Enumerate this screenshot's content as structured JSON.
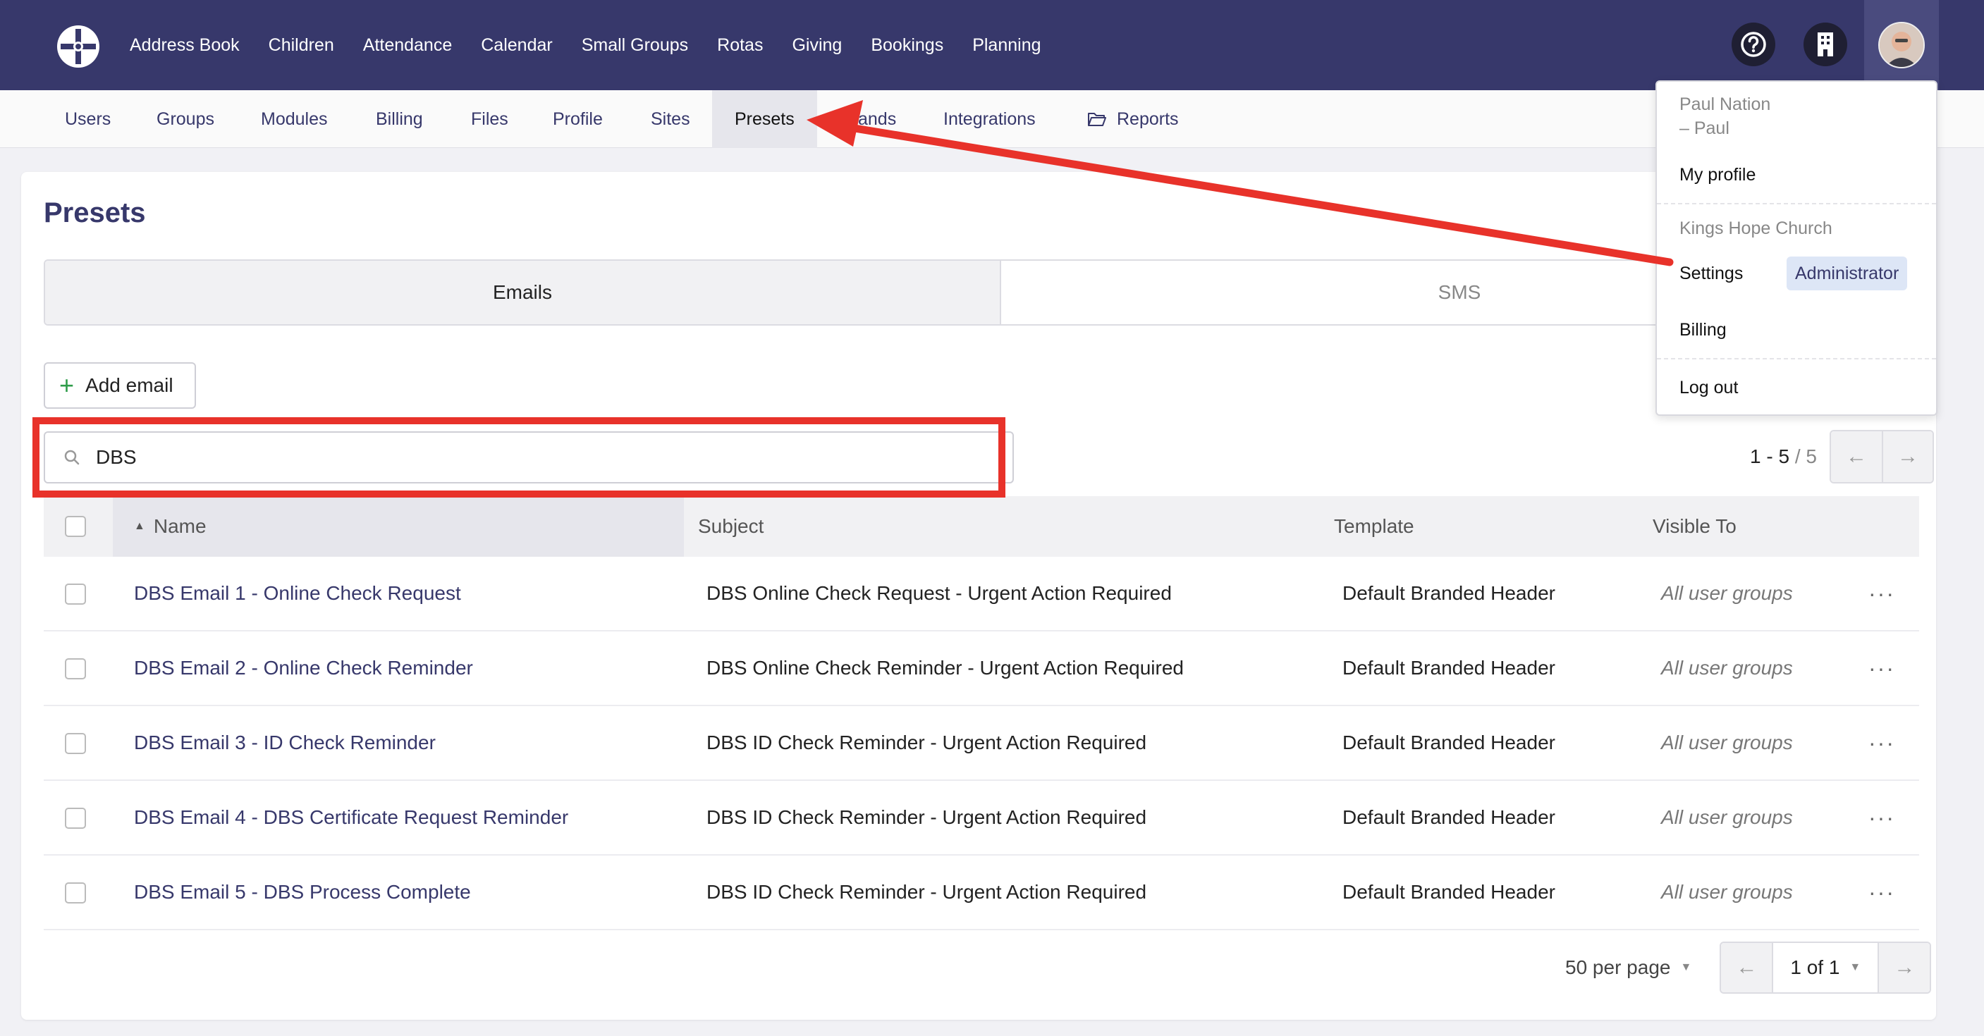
{
  "topnav": {
    "links": [
      "Address Book",
      "Children",
      "Attendance",
      "Calendar",
      "Small Groups",
      "Rotas",
      "Giving",
      "Bookings",
      "Planning"
    ]
  },
  "subnav": {
    "items": [
      "Users",
      "Groups",
      "Modules",
      "Billing",
      "Files",
      "Profile",
      "Sites",
      "Presets",
      "Brands",
      "Integrations",
      "Reports"
    ],
    "active": "Presets"
  },
  "page": {
    "title": "Presets",
    "tabs": [
      "Emails",
      "SMS"
    ],
    "add_label": "Add email"
  },
  "search": {
    "value": "DBS"
  },
  "pager_top": {
    "range": "1 - 5",
    "total": "/ 5"
  },
  "table": {
    "headers": [
      "Name",
      "Subject",
      "Template",
      "Visible To"
    ],
    "rows": [
      {
        "name": "DBS Email 1 - Online Check Request",
        "subject": "DBS Online Check Request - Urgent Action Required",
        "template": "Default Branded Header",
        "visible": "All user groups"
      },
      {
        "name": "DBS Email 2 - Online Check Reminder",
        "subject": "DBS Online Check Reminder - Urgent Action Required",
        "template": "Default Branded Header",
        "visible": "All user groups"
      },
      {
        "name": "DBS Email 3 - ID Check Reminder",
        "subject": "DBS ID Check Reminder - Urgent Action Required",
        "template": "Default Branded Header",
        "visible": "All user groups"
      },
      {
        "name": "DBS Email 4 - DBS Certificate Request Reminder",
        "subject": "DBS ID Check Reminder - Urgent Action Required",
        "template": "Default Branded Header",
        "visible": "All user groups"
      },
      {
        "name": "DBS Email 5 - DBS Process Complete",
        "subject": "DBS ID Check Reminder - Urgent Action Required",
        "template": "Default Branded Header",
        "visible": "All user groups"
      }
    ],
    "row_menu": "···"
  },
  "pager_bottom": {
    "per_page": "50 per page",
    "page": "1 of 1"
  },
  "dropdown": {
    "user_name": "Paul Nation",
    "user_nick": "– Paul",
    "my_profile": "My profile",
    "org": "Kings Hope Church",
    "settings": "Settings",
    "role_badge": "Administrator",
    "billing": "Billing",
    "logout": "Log out"
  },
  "icons": {
    "logo": "church-logo-icon",
    "help": "question-circle-icon",
    "building": "building-icon",
    "search": "search-icon",
    "arrow_left": "arrow-left-icon",
    "arrow_right": "arrow-right-icon",
    "folder": "folder-open-icon"
  },
  "colors": {
    "topnav": "#37386b",
    "link": "#37386b",
    "annotation": "#e8322a",
    "badge_bg": "#dde6f6"
  }
}
